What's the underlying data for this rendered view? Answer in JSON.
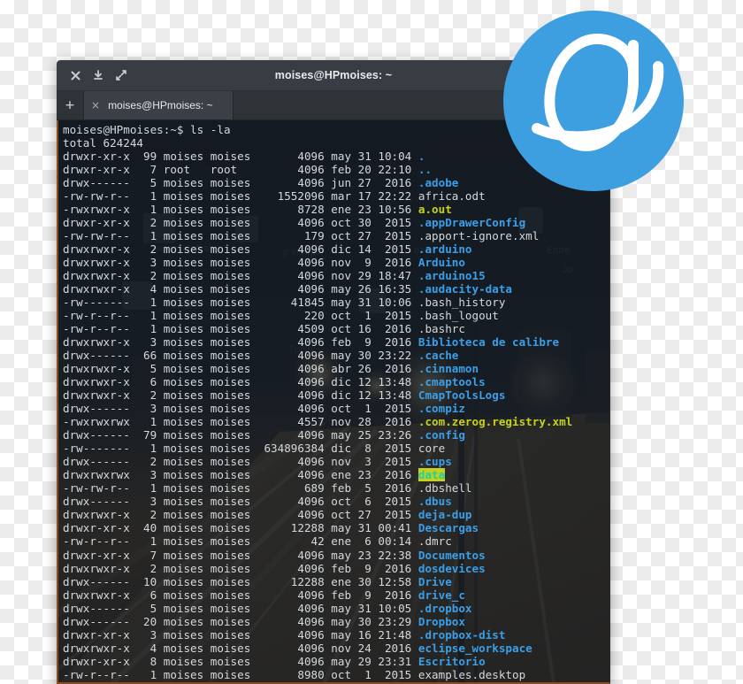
{
  "window": {
    "title": "moises@HPmoises: ~",
    "controls": [
      {
        "name": "close",
        "glyph": "close-icon"
      },
      {
        "name": "minimize",
        "glyph": "minimize-icon"
      },
      {
        "name": "maximize",
        "glyph": "maximize-icon"
      }
    ]
  },
  "tabbar": {
    "new_tab_label": "+",
    "tab_close_label": "×",
    "tab_label": "moises@HPmoises: ~"
  },
  "colors": {
    "accent_blue": "#3b9fe8",
    "directory": "#3b9fe8",
    "executable": "#c8d01e",
    "plain_file": "#d4d9dd",
    "other_writable_bg": "#c8d01e",
    "other_writable_fg": "#1fd0a0",
    "titlebar_bg": "#373d42",
    "tabbar_bg": "#2e3338",
    "terminal_bg": "#1b2026",
    "window_border": "#8a4b1e",
    "logo_blue": "#3d9ee0"
  },
  "terminal": {
    "prompt": "moises@HPmoises:~$",
    "command": "ls -la",
    "total_line": "total 624244",
    "columns": [
      "perms",
      "links",
      "owner",
      "group",
      "size",
      "month",
      "day",
      "time",
      "name"
    ],
    "entries": [
      {
        "perms": "drwxr-xr-x",
        "links": "99",
        "owner": "moises",
        "group": "moises",
        "size": "4096",
        "month": "may",
        "day": "31",
        "time": "10:04",
        "name": ".",
        "kind": "dir"
      },
      {
        "perms": "drwxr-xr-x",
        "links": "7",
        "owner": "root",
        "group": "root",
        "size": "4096",
        "month": "feb",
        "day": "20",
        "time": "22:10",
        "name": "..",
        "kind": "dir"
      },
      {
        "perms": "drwx------",
        "links": "5",
        "owner": "moises",
        "group": "moises",
        "size": "4096",
        "month": "jun",
        "day": "27",
        "time": "2016",
        "name": ".adobe",
        "kind": "dir"
      },
      {
        "perms": "-rw-rw-r--",
        "links": "1",
        "owner": "moises",
        "group": "moises",
        "size": "1552096",
        "month": "mar",
        "day": "17",
        "time": "22:22",
        "name": "africa.odt",
        "kind": "file"
      },
      {
        "perms": "-rwxrwxr-x",
        "links": "1",
        "owner": "moises",
        "group": "moises",
        "size": "8728",
        "month": "ene",
        "day": "23",
        "time": "10:56",
        "name": "a.out",
        "kind": "exe"
      },
      {
        "perms": "drwxr-xr-x",
        "links": "2",
        "owner": "moises",
        "group": "moises",
        "size": "4096",
        "month": "oct",
        "day": "30",
        "time": "2015",
        "name": ".appDrawerConfig",
        "kind": "dir"
      },
      {
        "perms": "-rw-rw-r--",
        "links": "1",
        "owner": "moises",
        "group": "moises",
        "size": "179",
        "month": "oct",
        "day": "27",
        "time": "2015",
        "name": ".apport-ignore.xml",
        "kind": "file"
      },
      {
        "perms": "drwxrwxr-x",
        "links": "2",
        "owner": "moises",
        "group": "moises",
        "size": "4096",
        "month": "dic",
        "day": "14",
        "time": "2015",
        "name": ".arduino",
        "kind": "dir"
      },
      {
        "perms": "drwxrwxr-x",
        "links": "3",
        "owner": "moises",
        "group": "moises",
        "size": "4096",
        "month": "nov",
        "day": "9",
        "time": "2016",
        "name": "Arduino",
        "kind": "dir"
      },
      {
        "perms": "drwxrwxr-x",
        "links": "2",
        "owner": "moises",
        "group": "moises",
        "size": "4096",
        "month": "nov",
        "day": "29",
        "time": "18:47",
        "name": ".arduino15",
        "kind": "dir"
      },
      {
        "perms": "drwxrwxr-x",
        "links": "4",
        "owner": "moises",
        "group": "moises",
        "size": "4096",
        "month": "may",
        "day": "26",
        "time": "16:35",
        "name": ".audacity-data",
        "kind": "dir"
      },
      {
        "perms": "-rw-------",
        "links": "1",
        "owner": "moises",
        "group": "moises",
        "size": "41845",
        "month": "may",
        "day": "31",
        "time": "10:06",
        "name": ".bash_history",
        "kind": "file"
      },
      {
        "perms": "-rw-r--r--",
        "links": "1",
        "owner": "moises",
        "group": "moises",
        "size": "220",
        "month": "oct",
        "day": "1",
        "time": "2015",
        "name": ".bash_logout",
        "kind": "file"
      },
      {
        "perms": "-rw-r--r--",
        "links": "1",
        "owner": "moises",
        "group": "moises",
        "size": "4509",
        "month": "oct",
        "day": "16",
        "time": "2016",
        "name": ".bashrc",
        "kind": "file"
      },
      {
        "perms": "drwxrwxr-x",
        "links": "3",
        "owner": "moises",
        "group": "moises",
        "size": "4096",
        "month": "feb",
        "day": "9",
        "time": "2016",
        "name": "Biblioteca de calibre",
        "kind": "dir"
      },
      {
        "perms": "drwx------",
        "links": "66",
        "owner": "moises",
        "group": "moises",
        "size": "4096",
        "month": "may",
        "day": "30",
        "time": "23:22",
        "name": ".cache",
        "kind": "dir"
      },
      {
        "perms": "drwxrwxr-x",
        "links": "5",
        "owner": "moises",
        "group": "moises",
        "size": "4096",
        "month": "abr",
        "day": "26",
        "time": "2016",
        "name": ".cinnamon",
        "kind": "dir"
      },
      {
        "perms": "drwxrwxr-x",
        "links": "6",
        "owner": "moises",
        "group": "moises",
        "size": "4096",
        "month": "dic",
        "day": "12",
        "time": "13:48",
        "name": ".cmaptools",
        "kind": "dir"
      },
      {
        "perms": "drwxrwxr-x",
        "links": "2",
        "owner": "moises",
        "group": "moises",
        "size": "4096",
        "month": "dic",
        "day": "12",
        "time": "13:48",
        "name": "CmapToolsLogs",
        "kind": "dir"
      },
      {
        "perms": "drwx------",
        "links": "3",
        "owner": "moises",
        "group": "moises",
        "size": "4096",
        "month": "oct",
        "day": "1",
        "time": "2015",
        "name": ".compiz",
        "kind": "dir"
      },
      {
        "perms": "-rwxrwxrwx",
        "links": "1",
        "owner": "moises",
        "group": "moises",
        "size": "4557",
        "month": "nov",
        "day": "28",
        "time": "2016",
        "name": ".com.zerog.registry.xml",
        "kind": "exe"
      },
      {
        "perms": "drwx------",
        "links": "79",
        "owner": "moises",
        "group": "moises",
        "size": "4096",
        "month": "may",
        "day": "25",
        "time": "23:26",
        "name": ".config",
        "kind": "dir"
      },
      {
        "perms": "-rw-------",
        "links": "1",
        "owner": "moises",
        "group": "moises",
        "size": "634896384",
        "month": "dic",
        "day": "8",
        "time": "2015",
        "name": "core",
        "kind": "file"
      },
      {
        "perms": "drwx------",
        "links": "2",
        "owner": "moises",
        "group": "moises",
        "size": "4096",
        "month": "nov",
        "day": "3",
        "time": "2015",
        "name": ".cups",
        "kind": "dir"
      },
      {
        "perms": "drwxrwxrwx",
        "links": "3",
        "owner": "moises",
        "group": "moises",
        "size": "4096",
        "month": "ene",
        "day": "23",
        "time": "2016",
        "name": "data",
        "kind": "ow"
      },
      {
        "perms": "-rw-rw-r--",
        "links": "1",
        "owner": "moises",
        "group": "moises",
        "size": "689",
        "month": "feb",
        "day": "5",
        "time": "2016",
        "name": ".dbshell",
        "kind": "file"
      },
      {
        "perms": "drwx------",
        "links": "3",
        "owner": "moises",
        "group": "moises",
        "size": "4096",
        "month": "oct",
        "day": "6",
        "time": "2015",
        "name": ".dbus",
        "kind": "dir"
      },
      {
        "perms": "drwxrwxr-x",
        "links": "2",
        "owner": "moises",
        "group": "moises",
        "size": "4096",
        "month": "oct",
        "day": "27",
        "time": "2015",
        "name": "deja-dup",
        "kind": "dir"
      },
      {
        "perms": "drwxr-xr-x",
        "links": "40",
        "owner": "moises",
        "group": "moises",
        "size": "12288",
        "month": "may",
        "day": "31",
        "time": "00:41",
        "name": "Descargas",
        "kind": "dir"
      },
      {
        "perms": "-rw-r--r--",
        "links": "1",
        "owner": "moises",
        "group": "moises",
        "size": "42",
        "month": "ene",
        "day": "6",
        "time": "00:14",
        "name": ".dmrc",
        "kind": "file"
      },
      {
        "perms": "drwxr-xr-x",
        "links": "7",
        "owner": "moises",
        "group": "moises",
        "size": "4096",
        "month": "may",
        "day": "23",
        "time": "22:38",
        "name": "Documentos",
        "kind": "dir"
      },
      {
        "perms": "drwxrwxr-x",
        "links": "2",
        "owner": "moises",
        "group": "moises",
        "size": "4096",
        "month": "feb",
        "day": "9",
        "time": "2016",
        "name": "dosdevices",
        "kind": "dir"
      },
      {
        "perms": "drwx------",
        "links": "10",
        "owner": "moises",
        "group": "moises",
        "size": "12288",
        "month": "ene",
        "day": "30",
        "time": "12:58",
        "name": "Drive",
        "kind": "dir"
      },
      {
        "perms": "drwxrwxr-x",
        "links": "6",
        "owner": "moises",
        "group": "moises",
        "size": "4096",
        "month": "feb",
        "day": "9",
        "time": "2016",
        "name": "drive_c",
        "kind": "dir"
      },
      {
        "perms": "drwx------",
        "links": "5",
        "owner": "moises",
        "group": "moises",
        "size": "4096",
        "month": "may",
        "day": "31",
        "time": "10:05",
        "name": ".dropbox",
        "kind": "dir"
      },
      {
        "perms": "drwx------",
        "links": "20",
        "owner": "moises",
        "group": "moises",
        "size": "4096",
        "month": "may",
        "day": "30",
        "time": "23:29",
        "name": "Dropbox",
        "kind": "dir"
      },
      {
        "perms": "drwxr-xr-x",
        "links": "3",
        "owner": "moises",
        "group": "moises",
        "size": "4096",
        "month": "may",
        "day": "16",
        "time": "21:48",
        "name": ".dropbox-dist",
        "kind": "dir"
      },
      {
        "perms": "drwxrwxr-x",
        "links": "4",
        "owner": "moises",
        "group": "moises",
        "size": "4096",
        "month": "nov",
        "day": "24",
        "time": "2016",
        "name": "eclipse_workspace",
        "kind": "dir"
      },
      {
        "perms": "drwxr-xr-x",
        "links": "8",
        "owner": "moises",
        "group": "moises",
        "size": "4096",
        "month": "may",
        "day": "29",
        "time": "23:31",
        "name": "Escritorio",
        "kind": "dir"
      },
      {
        "perms": "-rw-r--r--",
        "links": "1",
        "owner": "moises",
        "group": "moises",
        "size": "8980",
        "month": "oct",
        "day": "1",
        "time": "2015",
        "name": "examples.desktop",
        "kind": "file"
      }
    ]
  },
  "logo": {
    "name": "elementary-os-logo"
  }
}
